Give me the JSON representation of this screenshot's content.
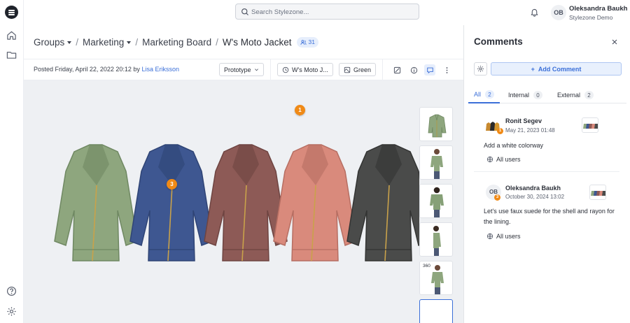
{
  "app": {
    "search_placeholder": "Search Stylezone...",
    "user_initials": "OB",
    "user_name": "Oleksandra Baukh",
    "user_org": "Stylezone Demo"
  },
  "breadcrumb": {
    "items": [
      "Groups",
      "Marketing",
      "Marketing Board",
      "W's Moto Jacket"
    ],
    "member_count": "31"
  },
  "info": {
    "posted_text": "Posted Friday, April 22, 2022 20:12 by",
    "author": "Lisa Eriksson",
    "stage_label": "Prototype",
    "style_label": "W's Moto J...",
    "colorway_label": "Green"
  },
  "pins": [
    "1",
    "3"
  ],
  "jackets": [
    {
      "color": "#8ea67e",
      "shade": "#6f8862"
    },
    {
      "color": "#3e5791",
      "shade": "#2f4475"
    },
    {
      "color": "#8d5a56",
      "shade": "#6e4441"
    },
    {
      "color": "#d98a7c",
      "shade": "#b66e62"
    },
    {
      "color": "#4a4b4a",
      "shade": "#333433"
    }
  ],
  "thumbnails": {
    "badge_360": "360"
  },
  "comments_panel": {
    "title": "Comments",
    "add_label": "Add Comment",
    "tabs": [
      {
        "label": "All",
        "count": "2"
      },
      {
        "label": "Internal",
        "count": "0"
      },
      {
        "label": "External",
        "count": "2"
      }
    ],
    "comments": [
      {
        "author": "Ronit Segev",
        "date": "May 21, 2023 01:48",
        "pin": "1",
        "text": "Add a white colorway",
        "visibility": "All users",
        "initials": ""
      },
      {
        "author": "Oleksandra Baukh",
        "date": "October 30, 2024 13:02",
        "pin": "3",
        "text": "Let's use faux suede for the shell and rayon for the lining.",
        "visibility": "All users",
        "initials": "OB"
      }
    ]
  },
  "colors": {
    "accent": "#3b6fd8",
    "pin": "#f08a16",
    "stage_bg": "#eef0f3"
  }
}
